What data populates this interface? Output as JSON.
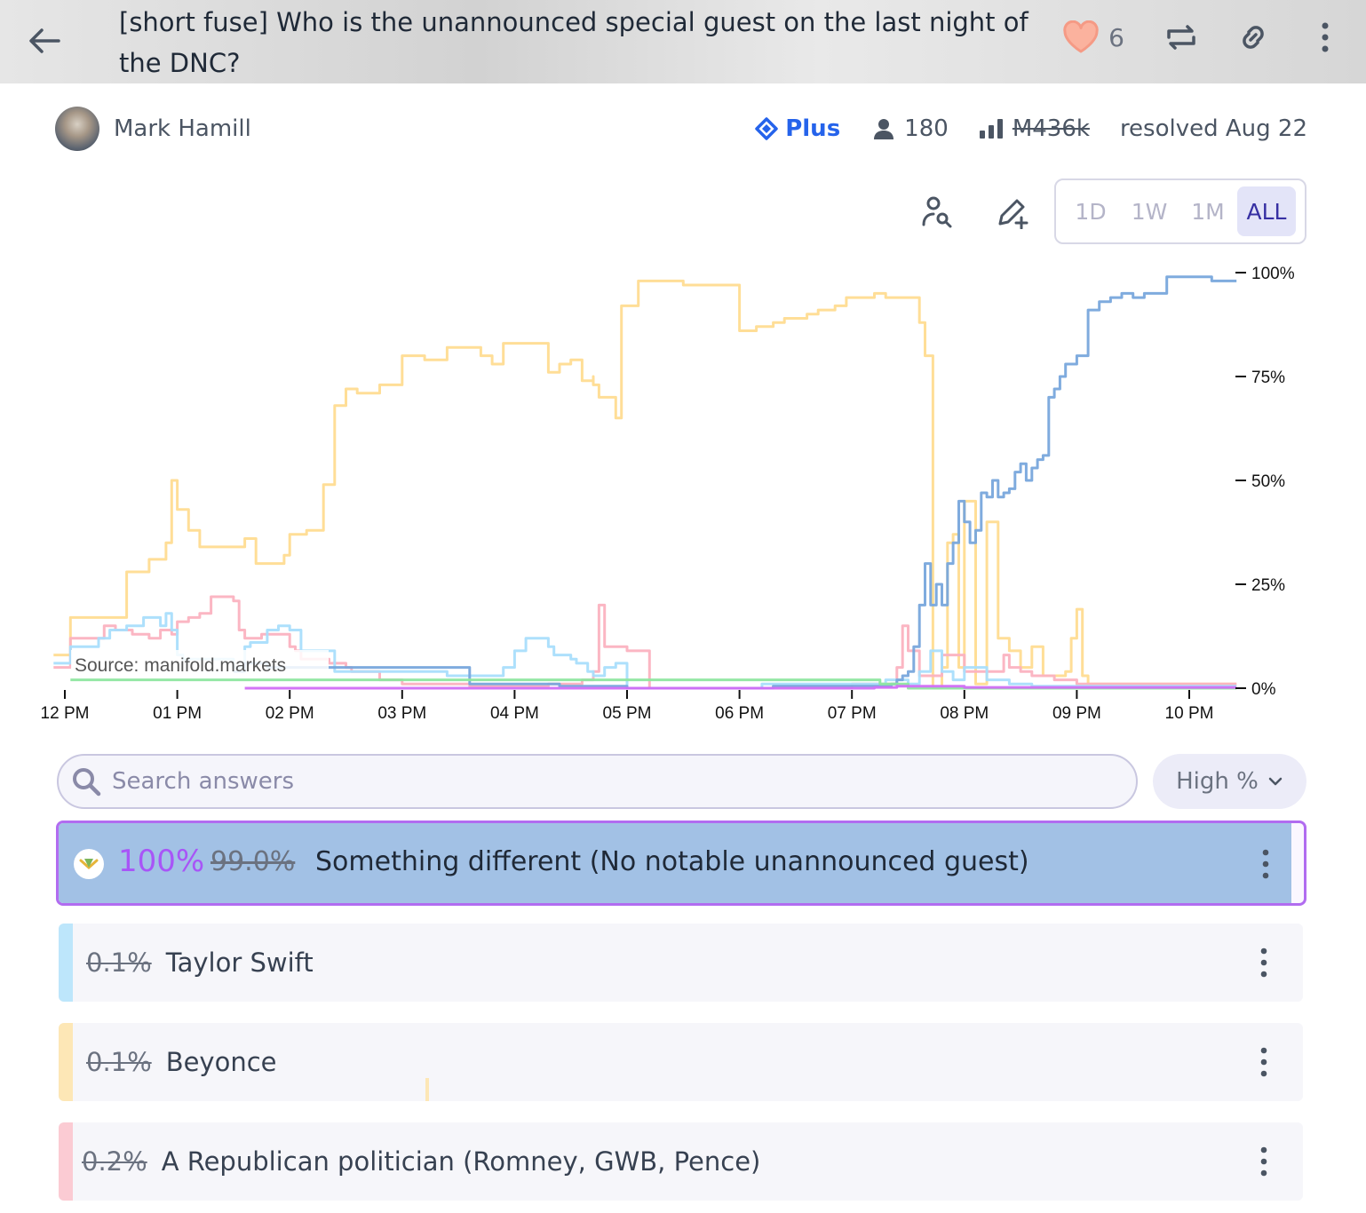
{
  "header": {
    "title": "[short fuse] Who is the unannounced special guest on the last night of the DNC?",
    "likes": "6"
  },
  "author": {
    "name": "Mark Hamill"
  },
  "stats": {
    "tier": "Plus",
    "traders": "180",
    "volume": "M436k",
    "status": "resolved Aug 22"
  },
  "timeframes": [
    "1D",
    "1W",
    "1M",
    "ALL"
  ],
  "active_timeframe": "ALL",
  "search": {
    "placeholder": "Search answers"
  },
  "sort": {
    "label": "High %"
  },
  "answers": [
    {
      "resolved_pct": "100%",
      "pct": "99.0%",
      "text": "Something different (No notable unannounced guest)",
      "color": "#78a6dc"
    },
    {
      "pct": "0.1%",
      "text": "Taylor Swift",
      "color": "#bde6fb"
    },
    {
      "pct": "0.1%",
      "text": "Beyonce",
      "color": "#fde7b6"
    },
    {
      "pct": "0.2%",
      "text": "A Republican politician (Romney, GWB, Pence)",
      "color": "#fbcbd3"
    }
  ],
  "chart_data": {
    "type": "line",
    "source_label": "Source: manifold.markets",
    "x_tick_labels": [
      "12 PM",
      "01 PM",
      "02 PM",
      "03 PM",
      "04 PM",
      "05 PM",
      "06 PM",
      "07 PM",
      "08 PM",
      "09 PM",
      "10 PM"
    ],
    "y_tick_labels": [
      "100%",
      "75%",
      "50%",
      "25%",
      "0%"
    ],
    "ylim": [
      0,
      100
    ],
    "xlim": [
      -0.1,
      10.42
    ],
    "series": [
      {
        "color": "#ffdc91",
        "points": [
          [
            -0.1,
            8
          ],
          [
            0.05,
            8
          ],
          [
            0.05,
            17
          ],
          [
            0.55,
            17
          ],
          [
            0.55,
            28
          ],
          [
            0.75,
            31
          ],
          [
            0.9,
            35
          ],
          [
            0.95,
            50
          ],
          [
            1.0,
            43
          ],
          [
            1.1,
            38
          ],
          [
            1.2,
            34
          ],
          [
            1.4,
            34
          ],
          [
            1.6,
            36
          ],
          [
            1.7,
            30
          ],
          [
            1.85,
            30
          ],
          [
            1.95,
            32
          ],
          [
            2.0,
            37
          ],
          [
            2.15,
            38
          ],
          [
            2.3,
            43
          ],
          [
            2.3,
            49
          ],
          [
            2.4,
            68
          ],
          [
            2.5,
            72
          ],
          [
            2.6,
            71
          ],
          [
            2.8,
            71
          ],
          [
            2.8,
            73
          ],
          [
            3.0,
            80
          ],
          [
            3.2,
            79
          ],
          [
            3.4,
            79
          ],
          [
            3.4,
            82
          ],
          [
            3.6,
            82
          ],
          [
            3.7,
            80
          ],
          [
            3.8,
            80
          ],
          [
            3.8,
            78
          ],
          [
            3.9,
            78
          ],
          [
            3.9,
            83
          ],
          [
            4.2,
            83
          ],
          [
            4.3,
            83
          ],
          [
            4.3,
            76
          ],
          [
            4.4,
            78
          ],
          [
            4.5,
            79
          ],
          [
            4.6,
            74
          ],
          [
            4.7,
            75
          ],
          [
            4.7,
            73
          ],
          [
            4.75,
            70
          ],
          [
            4.9,
            65
          ],
          [
            4.95,
            72
          ],
          [
            4.95,
            92
          ],
          [
            5.1,
            98
          ],
          [
            5.2,
            98
          ],
          [
            5.5,
            97
          ],
          [
            5.8,
            97
          ],
          [
            5.95,
            97
          ],
          [
            6.0,
            92
          ],
          [
            6.0,
            86
          ],
          [
            6.15,
            87
          ],
          [
            6.3,
            88
          ],
          [
            6.4,
            89
          ],
          [
            6.6,
            90
          ],
          [
            6.7,
            91
          ],
          [
            6.85,
            92
          ],
          [
            6.95,
            94
          ],
          [
            7.1,
            94
          ],
          [
            7.2,
            94
          ],
          [
            7.2,
            95
          ],
          [
            7.3,
            94
          ],
          [
            7.6,
            94
          ],
          [
            7.6,
            88
          ],
          [
            7.65,
            80
          ],
          [
            7.72,
            0
          ],
          [
            7.8,
            5
          ],
          [
            7.85,
            35
          ],
          [
            7.9,
            37
          ],
          [
            7.95,
            5
          ],
          [
            8.0,
            45
          ],
          [
            8.1,
            1
          ],
          [
            8.2,
            40
          ],
          [
            8.3,
            12
          ],
          [
            8.4,
            9
          ],
          [
            8.5,
            5
          ],
          [
            8.6,
            10
          ],
          [
            8.7,
            3
          ],
          [
            8.8,
            3
          ],
          [
            8.9,
            4
          ],
          [
            8.95,
            12
          ],
          [
            9.0,
            19
          ],
          [
            9.05,
            3
          ],
          [
            9.1,
            1
          ],
          [
            9.3,
            1
          ],
          [
            9.5,
            1
          ],
          [
            10.42,
            1
          ]
        ]
      },
      {
        "color": "#fbb2c0",
        "points": [
          [
            -0.1,
            5
          ],
          [
            0.05,
            5
          ],
          [
            0.05,
            12
          ],
          [
            0.3,
            12
          ],
          [
            0.35,
            15
          ],
          [
            0.45,
            14
          ],
          [
            0.55,
            14
          ],
          [
            0.6,
            13
          ],
          [
            0.75,
            12
          ],
          [
            0.85,
            14
          ],
          [
            0.95,
            13
          ],
          [
            1.0,
            16
          ],
          [
            1.1,
            17
          ],
          [
            1.2,
            18
          ],
          [
            1.3,
            22
          ],
          [
            1.45,
            22
          ],
          [
            1.5,
            21
          ],
          [
            1.55,
            14
          ],
          [
            1.6,
            12
          ],
          [
            1.7,
            12
          ],
          [
            1.75,
            13
          ],
          [
            1.85,
            13
          ],
          [
            1.95,
            13
          ],
          [
            2.0,
            10
          ],
          [
            2.05,
            9
          ],
          [
            2.1,
            7
          ],
          [
            2.2,
            7
          ],
          [
            2.3,
            7
          ],
          [
            2.35,
            6
          ],
          [
            2.45,
            6
          ],
          [
            2.5,
            5
          ],
          [
            2.55,
            4
          ],
          [
            2.6,
            4
          ],
          [
            2.8,
            2
          ],
          [
            3.0,
            1
          ],
          [
            3.2,
            1
          ],
          [
            3.4,
            1
          ],
          [
            3.6,
            0.5
          ],
          [
            4.0,
            0.5
          ],
          [
            4.3,
            1
          ],
          [
            4.6,
            2
          ],
          [
            4.7,
            4
          ],
          [
            4.75,
            20
          ],
          [
            4.8,
            10
          ],
          [
            4.9,
            10
          ],
          [
            5.0,
            9
          ],
          [
            5.2,
            0
          ],
          [
            5.4,
            0
          ],
          [
            5.6,
            0
          ],
          [
            6.0,
            0
          ],
          [
            6.3,
            0.2
          ],
          [
            7.0,
            1
          ],
          [
            7.3,
            1
          ],
          [
            7.4,
            5
          ],
          [
            7.45,
            15
          ],
          [
            7.5,
            9
          ],
          [
            7.6,
            3
          ],
          [
            7.8,
            8
          ],
          [
            8.0,
            4
          ],
          [
            8.2,
            4
          ],
          [
            8.35,
            8
          ],
          [
            8.4,
            5
          ],
          [
            8.5,
            4
          ],
          [
            8.6,
            3
          ],
          [
            8.8,
            2
          ],
          [
            9.0,
            1
          ],
          [
            9.1,
            1
          ],
          [
            9.3,
            1
          ],
          [
            9.6,
            1
          ],
          [
            10.42,
            1
          ]
        ]
      },
      {
        "color": "#a9defc",
        "points": [
          [
            -0.1,
            6
          ],
          [
            0.05,
            6
          ],
          [
            0.05,
            10
          ],
          [
            0.3,
            12
          ],
          [
            0.4,
            14
          ],
          [
            0.55,
            15
          ],
          [
            0.65,
            15
          ],
          [
            0.7,
            17
          ],
          [
            0.8,
            17
          ],
          [
            0.85,
            15
          ],
          [
            0.9,
            18
          ],
          [
            0.95,
            14
          ],
          [
            1.0,
            8
          ],
          [
            1.05,
            7
          ],
          [
            1.1,
            7
          ],
          [
            1.4,
            7
          ],
          [
            1.5,
            5
          ],
          [
            1.6,
            10
          ],
          [
            1.65,
            11
          ],
          [
            1.8,
            14
          ],
          [
            1.9,
            15
          ],
          [
            2.0,
            14
          ],
          [
            2.1,
            9
          ],
          [
            2.2,
            9
          ],
          [
            2.3,
            9
          ],
          [
            2.4,
            4
          ],
          [
            3.0,
            4
          ],
          [
            3.2,
            4
          ],
          [
            3.4,
            3
          ],
          [
            3.6,
            3
          ],
          [
            3.9,
            5
          ],
          [
            4.0,
            9
          ],
          [
            4.1,
            12
          ],
          [
            4.2,
            12
          ],
          [
            4.3,
            10
          ],
          [
            4.35,
            8
          ],
          [
            4.4,
            8
          ],
          [
            4.5,
            7
          ],
          [
            4.55,
            6
          ],
          [
            4.6,
            6
          ],
          [
            4.65,
            4
          ],
          [
            4.7,
            3
          ],
          [
            4.8,
            5
          ],
          [
            4.9,
            6
          ],
          [
            5.0,
            0
          ],
          [
            6.0,
            0
          ],
          [
            6.2,
            1
          ],
          [
            6.5,
            1
          ],
          [
            7.0,
            1
          ],
          [
            7.3,
            2
          ],
          [
            7.5,
            1
          ],
          [
            7.6,
            4
          ],
          [
            7.7,
            9
          ],
          [
            7.8,
            4
          ],
          [
            7.9,
            2
          ],
          [
            8.0,
            5
          ],
          [
            8.2,
            2
          ],
          [
            8.4,
            1
          ],
          [
            8.6,
            0.5
          ],
          [
            9.0,
            0.5
          ],
          [
            10.42,
            0.5
          ]
        ]
      },
      {
        "color": "#78a6dc",
        "points": [
          [
            1.5,
            4
          ],
          [
            1.55,
            4
          ],
          [
            1.6,
            6
          ],
          [
            1.7,
            6
          ],
          [
            1.8,
            5
          ],
          [
            2.0,
            5
          ],
          [
            2.2,
            5
          ],
          [
            2.4,
            5
          ],
          [
            2.6,
            5
          ],
          [
            2.8,
            5
          ],
          [
            3.0,
            5
          ],
          [
            3.2,
            5
          ],
          [
            3.4,
            5
          ],
          [
            3.5,
            5
          ],
          [
            3.6,
            1
          ],
          [
            3.8,
            1
          ],
          [
            4.0,
            1
          ],
          [
            4.2,
            1
          ],
          [
            4.4,
            0.5
          ],
          [
            4.8,
            0.5
          ],
          [
            5.0,
            0
          ],
          [
            6.0,
            0
          ],
          [
            6.3,
            0.5
          ],
          [
            7.0,
            0.5
          ],
          [
            7.2,
            0.5
          ],
          [
            7.35,
            1
          ],
          [
            7.4,
            2
          ],
          [
            7.45,
            3
          ],
          [
            7.5,
            4
          ],
          [
            7.55,
            10
          ],
          [
            7.6,
            20
          ],
          [
            7.65,
            30
          ],
          [
            7.7,
            20
          ],
          [
            7.75,
            25
          ],
          [
            7.8,
            20
          ],
          [
            7.85,
            30
          ],
          [
            7.9,
            35
          ],
          [
            7.95,
            45
          ],
          [
            8.0,
            40
          ],
          [
            8.05,
            35
          ],
          [
            8.1,
            38
          ],
          [
            8.15,
            47
          ],
          [
            8.2,
            46
          ],
          [
            8.25,
            50
          ],
          [
            8.3,
            46
          ],
          [
            8.35,
            47
          ],
          [
            8.4,
            48
          ],
          [
            8.45,
            52
          ],
          [
            8.5,
            54
          ],
          [
            8.55,
            50
          ],
          [
            8.6,
            53
          ],
          [
            8.65,
            55
          ],
          [
            8.7,
            56
          ],
          [
            8.75,
            70
          ],
          [
            8.8,
            72
          ],
          [
            8.85,
            75
          ],
          [
            8.9,
            78
          ],
          [
            9.0,
            80
          ],
          [
            9.1,
            91
          ],
          [
            9.2,
            93
          ],
          [
            9.3,
            94
          ],
          [
            9.4,
            95
          ],
          [
            9.5,
            94
          ],
          [
            9.6,
            95
          ],
          [
            9.7,
            95
          ],
          [
            9.8,
            99
          ],
          [
            10.0,
            99
          ],
          [
            10.2,
            98
          ],
          [
            10.42,
            98
          ]
        ]
      },
      {
        "color": "#8ee6a0",
        "points": [
          [
            0.05,
            2
          ],
          [
            0.9,
            2
          ],
          [
            1.5,
            2
          ],
          [
            2.0,
            2
          ],
          [
            3.0,
            2
          ],
          [
            3.4,
            2
          ],
          [
            3.5,
            2
          ],
          [
            4.5,
            2
          ],
          [
            5.0,
            2
          ],
          [
            6.0,
            2
          ],
          [
            7.0,
            2
          ],
          [
            7.1,
            2
          ],
          [
            7.2,
            2
          ],
          [
            7.25,
            1
          ],
          [
            7.4,
            1
          ],
          [
            7.5,
            0
          ],
          [
            9.0,
            0
          ],
          [
            10.42,
            0
          ]
        ]
      },
      {
        "color": "#d16ef6",
        "points": [
          [
            1.6,
            0
          ],
          [
            2.0,
            0
          ],
          [
            3.0,
            0
          ],
          [
            3.5,
            0
          ],
          [
            4.0,
            0
          ],
          [
            7.2,
            0.2
          ],
          [
            7.4,
            0.5
          ],
          [
            8.0,
            0.2
          ],
          [
            10.42,
            0.2
          ]
        ]
      }
    ]
  }
}
